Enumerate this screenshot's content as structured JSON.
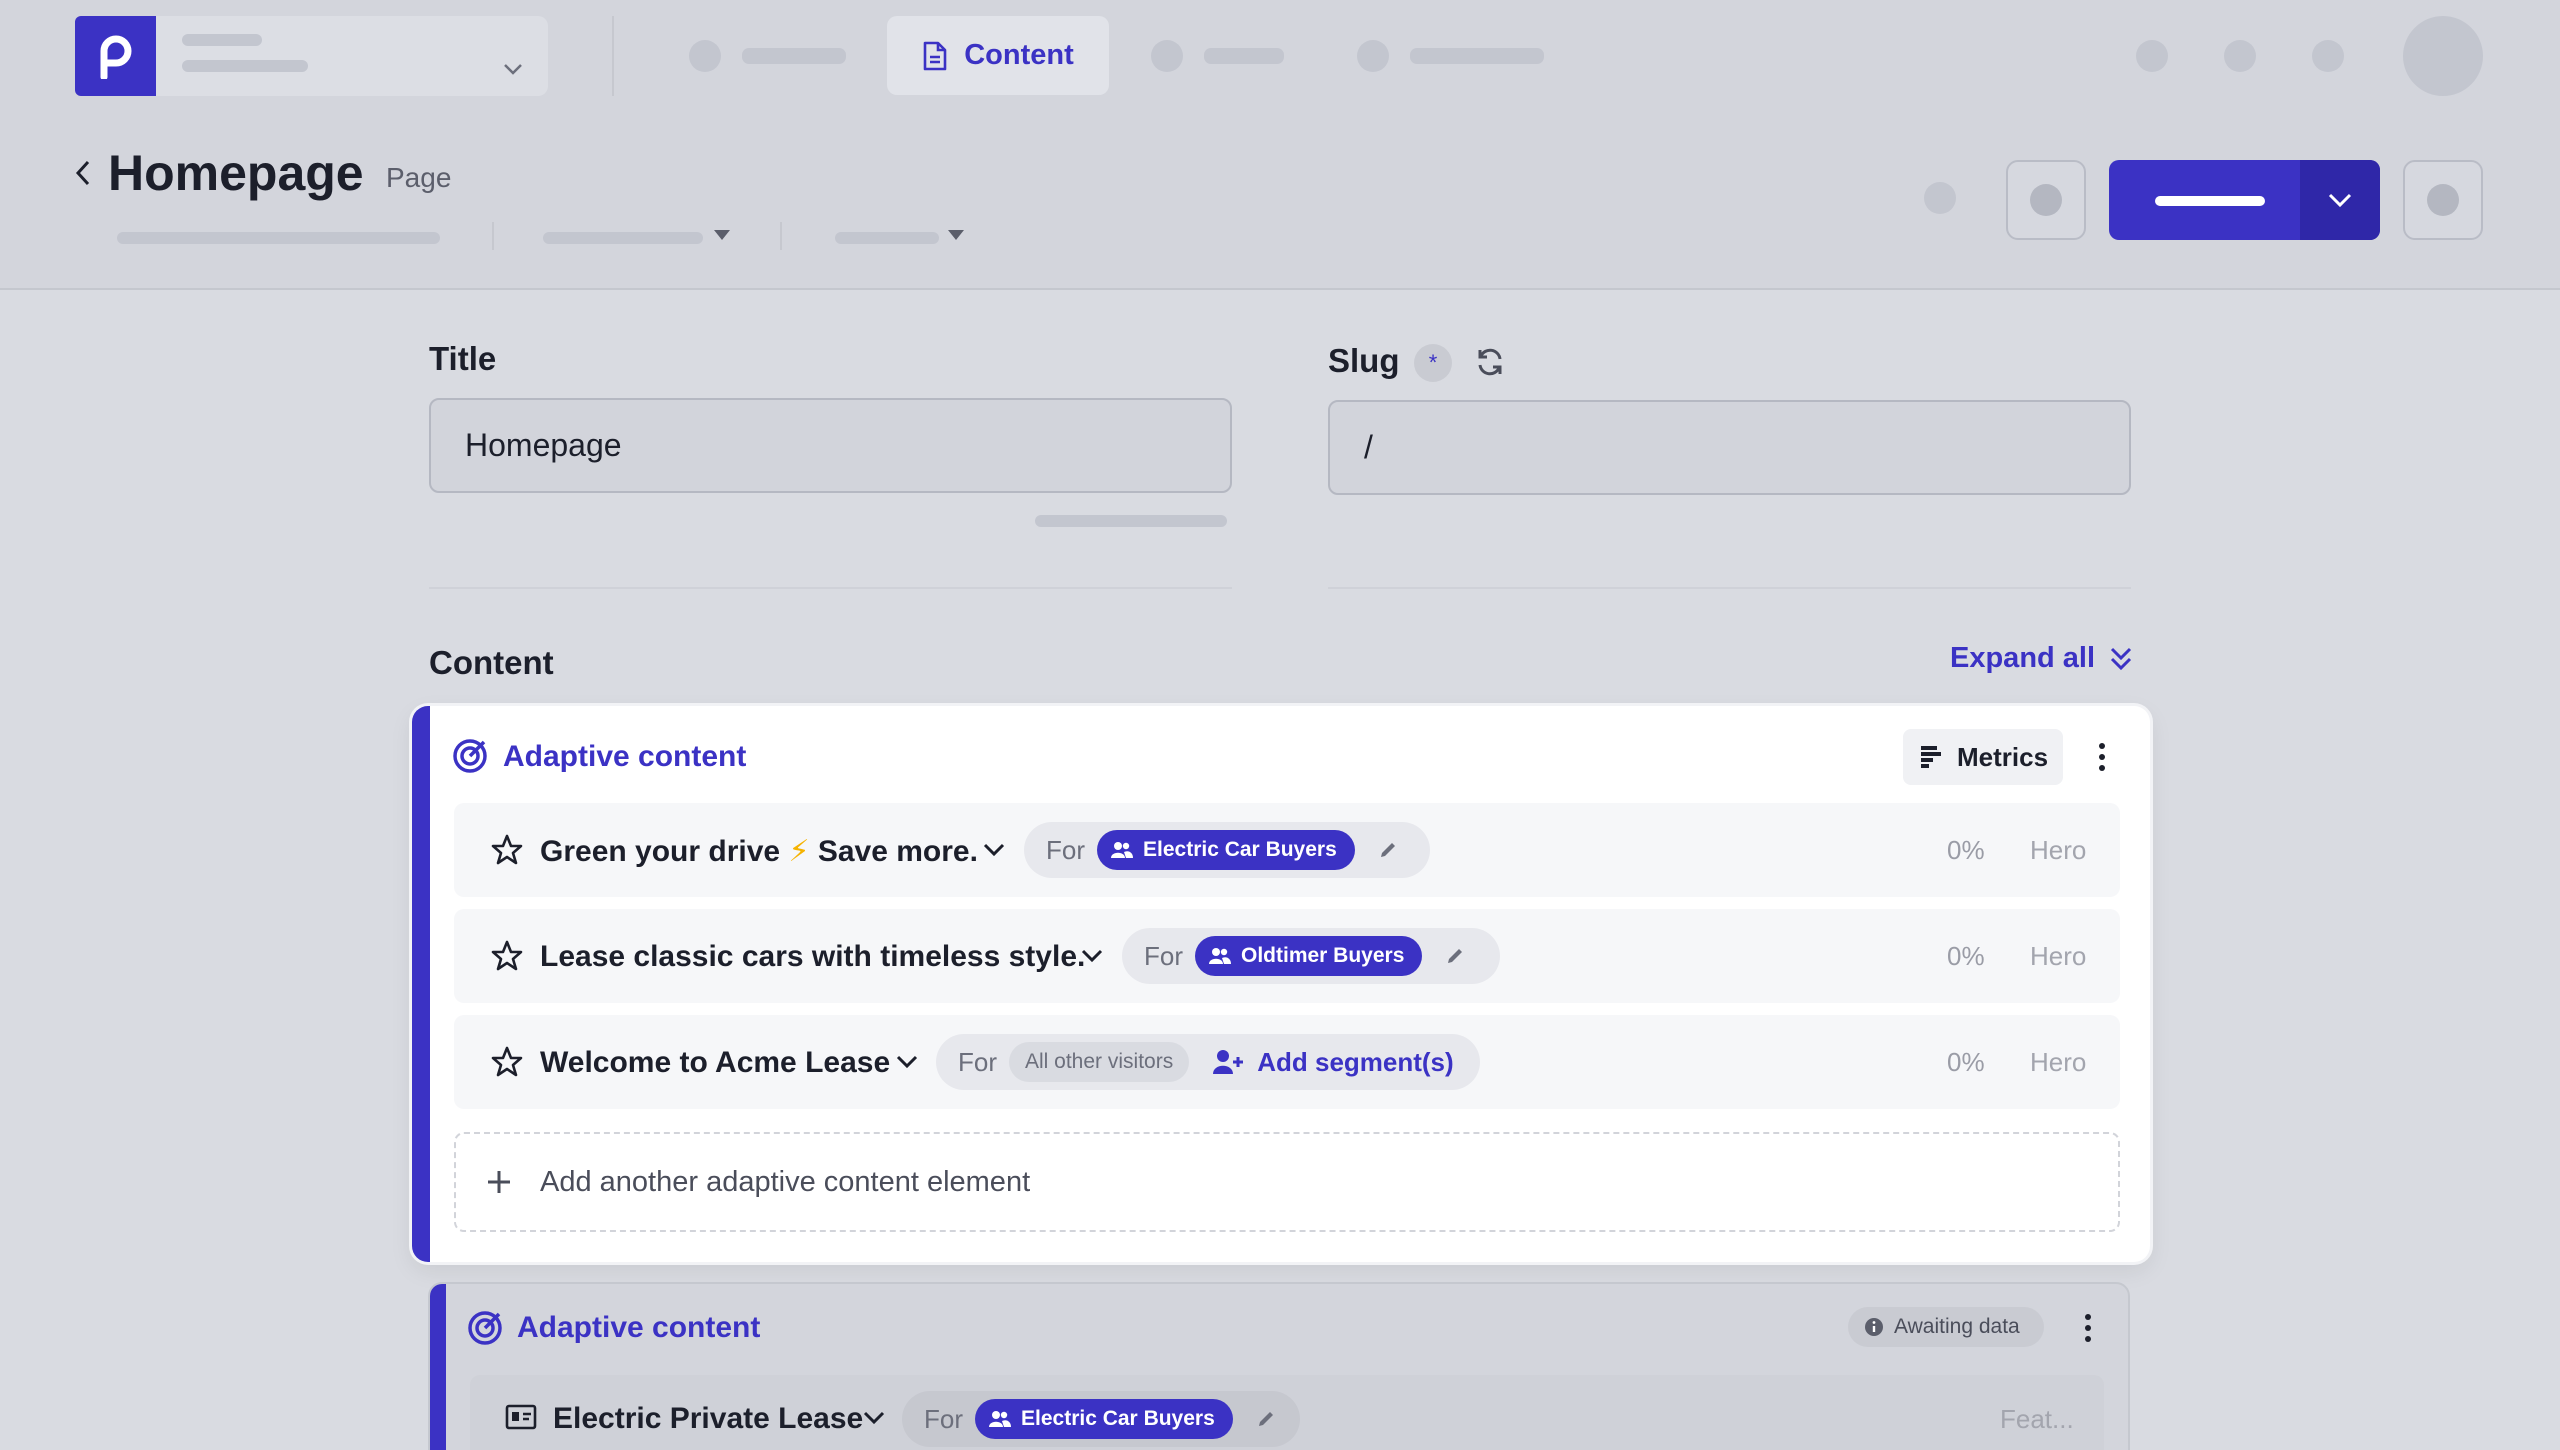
{
  "nav": {
    "active_tab": "Content"
  },
  "page": {
    "title": "Homepage",
    "type": "Page"
  },
  "fields": {
    "title_label": "Title",
    "title_value": "Homepage",
    "slug_label": "Slug",
    "slug_required": "*",
    "slug_value": "/"
  },
  "content": {
    "section_label": "Content",
    "expand_all": "Expand all",
    "blocks": [
      {
        "title": "Adaptive content",
        "metrics_label": "Metrics",
        "rows": [
          {
            "title": "Green your drive",
            "emoji": "⚡",
            "title_suffix": "Save more.",
            "for_label": "For",
            "segment": "Electric Car Buyers",
            "percent": "0%",
            "slot": "Hero"
          },
          {
            "title": "Lease classic cars with timeless style.",
            "for_label": "For",
            "segment": "Oldtimer Buyers",
            "percent": "0%",
            "slot": "Hero"
          },
          {
            "title": "Welcome to Acme Lease",
            "for_label": "For",
            "segment": "All other visitors",
            "add_segment": "Add segment(s)",
            "percent": "0%",
            "slot": "Hero"
          }
        ],
        "add_element": "Add another adaptive content element"
      },
      {
        "title": "Adaptive content",
        "status": "Awaiting data",
        "rows": [
          {
            "title": "Electric Private Lease",
            "for_label": "For",
            "segment": "Electric Car Buyers",
            "slot": "Feat..."
          }
        ]
      }
    ]
  },
  "colors": {
    "brand": "#3b32c4",
    "background": "#d9dbe1",
    "card": "#ffffff"
  }
}
